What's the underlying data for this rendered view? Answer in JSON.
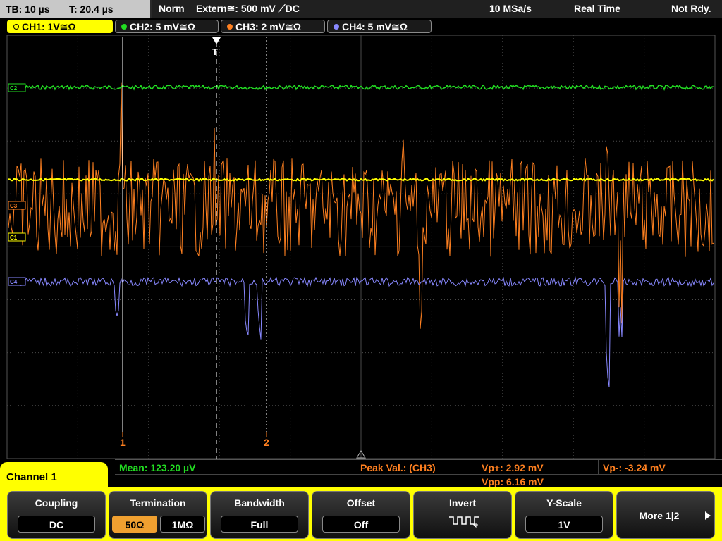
{
  "status_bar": {
    "timebase": "TB: 10 µs",
    "trigger_time": "T: 20.4 µs",
    "trigger_mode": "Norm",
    "trigger_source": "Extern≅: 500 mV ⟋DC",
    "sample_rate": "10 MSa/s",
    "acquisition_mode": "Real Time",
    "run_status": "Not Rdy."
  },
  "channels": [
    {
      "id": "ch1",
      "label": "CH1: 1V≅Ω",
      "color": "#ffff00",
      "marker": "C1"
    },
    {
      "id": "ch2",
      "label": "CH2: 5 mV≅Ω",
      "color": "#22dd22",
      "marker": "C2"
    },
    {
      "id": "ch3",
      "label": "CH3: 2 mV≅Ω",
      "color": "#ff8020",
      "marker": "C3"
    },
    {
      "id": "ch4",
      "label": "CH4: 5 mV≅Ω",
      "color": "#8888ff",
      "marker": "C4"
    }
  ],
  "markers": {
    "trigger": "T",
    "cursor1": "1",
    "cursor2": "2"
  },
  "measurements": {
    "mean": "Mean: 123.20 µV",
    "peak_title": "Peak Val.:  (CH3)",
    "vp_plus": "Vp+: 2.92 mV",
    "vp_minus": "Vp-: -3.24 mV",
    "vpp": "Vpp: 6.16 mV"
  },
  "menu": {
    "title": "Channel 1",
    "coupling": {
      "label": "Coupling",
      "value": "DC"
    },
    "termination": {
      "label": "Termination",
      "options": [
        "50Ω",
        "1MΩ"
      ],
      "selected": "50Ω"
    },
    "bandwidth": {
      "label": "Bandwidth",
      "value": "Full"
    },
    "offset": {
      "label": "Offset",
      "value": "Off"
    },
    "invert": {
      "label": "Invert"
    },
    "yscale": {
      "label": "Y-Scale",
      "value": "1V"
    },
    "more": {
      "label": "More 1|2"
    }
  },
  "colors": {
    "grid": "#4a4a4a",
    "ch1": "#ffff00",
    "ch2": "#22dd22",
    "ch3": "#ff8020",
    "ch4": "#8888ff",
    "menu_bg": "#ffff00",
    "selected_option": "#f0a030"
  }
}
